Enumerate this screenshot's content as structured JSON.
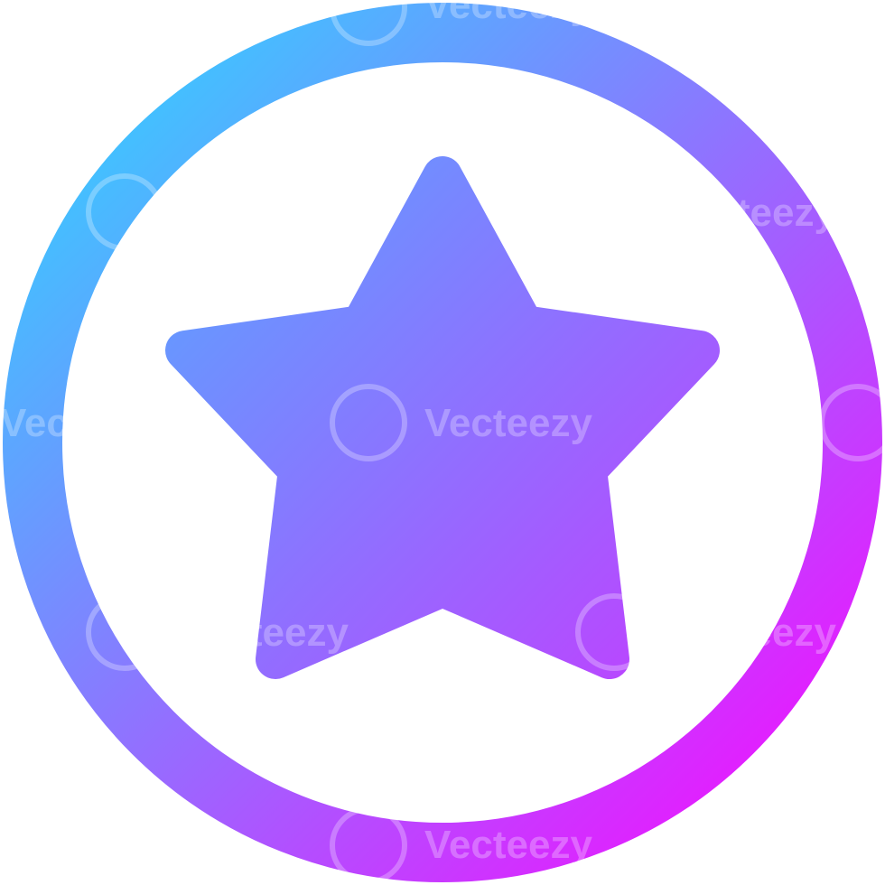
{
  "icon": {
    "name": "star-in-circle-icon",
    "gradient_start": "#3ec5ff",
    "gradient_end": "#e61bff"
  },
  "watermark": {
    "text": "Vecteezy"
  }
}
